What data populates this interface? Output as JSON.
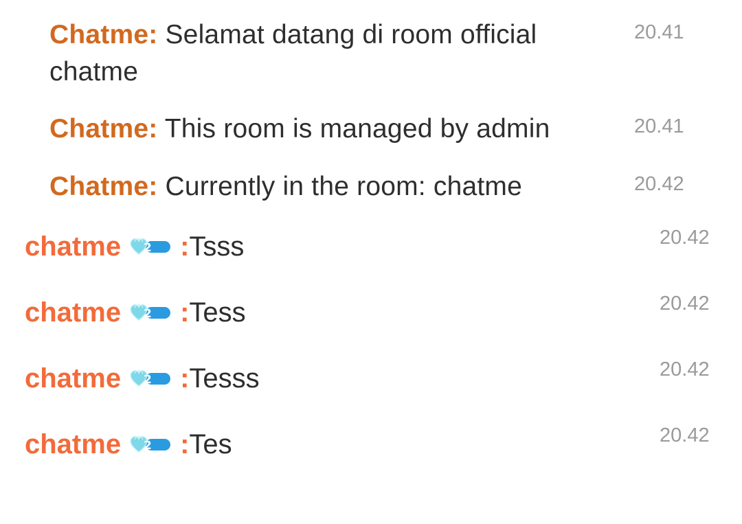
{
  "system_messages": [
    {
      "sender": "Chatme:",
      "text": "Selamat datang di room official chatme",
      "time": "20.41"
    },
    {
      "sender": "Chatme:",
      "text": "This room is managed by admin",
      "time": "20.41"
    },
    {
      "sender": "Chatme:",
      "text": "Currently in the room: chatme",
      "time": "20.42"
    }
  ],
  "user_messages": [
    {
      "username": "chatme",
      "badge_level": "2",
      "separator": ":",
      "text": "Tsss",
      "time": "20.42"
    },
    {
      "username": "chatme",
      "badge_level": "2",
      "separator": ":",
      "text": "Tess",
      "time": "20.42"
    },
    {
      "username": "chatme",
      "badge_level": "2",
      "separator": ":",
      "text": "Tesss",
      "time": "20.42"
    },
    {
      "username": "chatme",
      "badge_level": "2",
      "separator": ":",
      "text": "Tes",
      "time": "20.42"
    }
  ],
  "colors": {
    "system_sender": "#d2691e",
    "username": "#f26b3a",
    "message_text": "#2e2e2e",
    "timestamp": "#9a9a9a",
    "badge_heart": "#7fd8e8",
    "badge_pill": "#2a9be0"
  },
  "icons": {
    "badge": "heart-level-badge-icon"
  }
}
